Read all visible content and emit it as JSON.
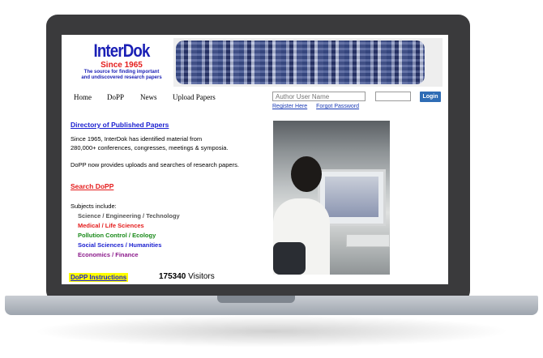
{
  "header": {
    "logo_title": "InterDok",
    "logo_since": "Since 1965",
    "logo_tagline_1": "The source for finding important",
    "logo_tagline_2": "and undiscovered research papers"
  },
  "nav": {
    "items": [
      {
        "label": "Home"
      },
      {
        "label": "DoPP"
      },
      {
        "label": "News"
      },
      {
        "label": "Upload Papers"
      }
    ]
  },
  "login": {
    "username_placeholder": "Author User Name",
    "password_value": "",
    "button_label": "Login",
    "register_link": "Register Here",
    "forgot_link": "Forgot Password"
  },
  "main": {
    "directory_link": "Directory of Published Papers",
    "intro_line_1": "Since 1965, InterDok has identified material from",
    "intro_line_2": "280,000+ conferences, congresses, meetings & symposia.",
    "dopp_text": "DoPP now provides uploads and searches of research papers.",
    "search_link": "Search DoPP",
    "subjects_label": "Subjects include:",
    "subjects": [
      {
        "label": "Science / Engineering / Technology",
        "color": "#555555"
      },
      {
        "label": "Medical / Life Sciences",
        "color": "#e41c1c"
      },
      {
        "label": "Pollution Control / Ecology",
        "color": "#1a8a1a"
      },
      {
        "label": "Social Sciences / Humanities",
        "color": "#1a1fd0"
      },
      {
        "label": "Economics / Finance",
        "color": "#8b1a8b"
      }
    ],
    "instructions_link": "DoPP Instructions",
    "visitors_count": "175340",
    "visitors_label": "Visitors"
  },
  "colors": {
    "brand_blue": "#1a1fb5",
    "accent_red": "#e41c1c",
    "login_button": "#2f6db5",
    "highlight": "#ffff00"
  }
}
